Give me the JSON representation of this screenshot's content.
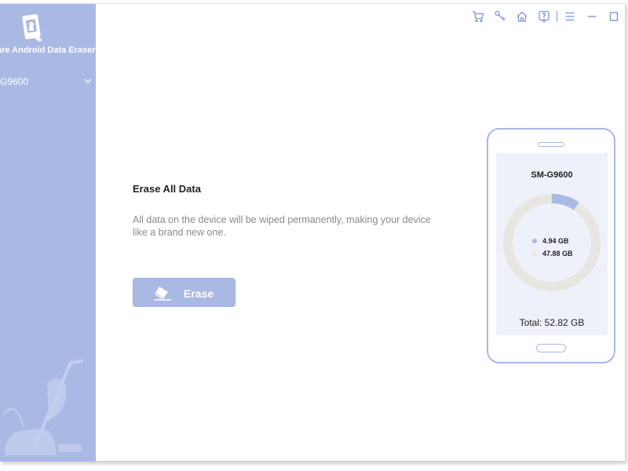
{
  "app": {
    "title": "are Android Data Eraser"
  },
  "sidebar": {
    "device": "-G9600"
  },
  "toolbar": {
    "items": [
      "cart-icon",
      "key-icon",
      "home-icon",
      "help-icon",
      "menu-icon",
      "minimize-icon",
      "maximize-icon"
    ]
  },
  "main": {
    "title": "Erase All Data",
    "description": "All data on the device will be wiped permanently, making your device like a brand new one.",
    "erase_label": "Erase"
  },
  "phone": {
    "model": "SM-G9600",
    "used": "4.94 GB",
    "free": "47.88 GB",
    "used_fraction": 0.094,
    "total": "Total: 52.82 GB"
  },
  "colors": {
    "accent": "#aab9e4",
    "used": "#aab9e4",
    "free": "#e7e6e0"
  }
}
